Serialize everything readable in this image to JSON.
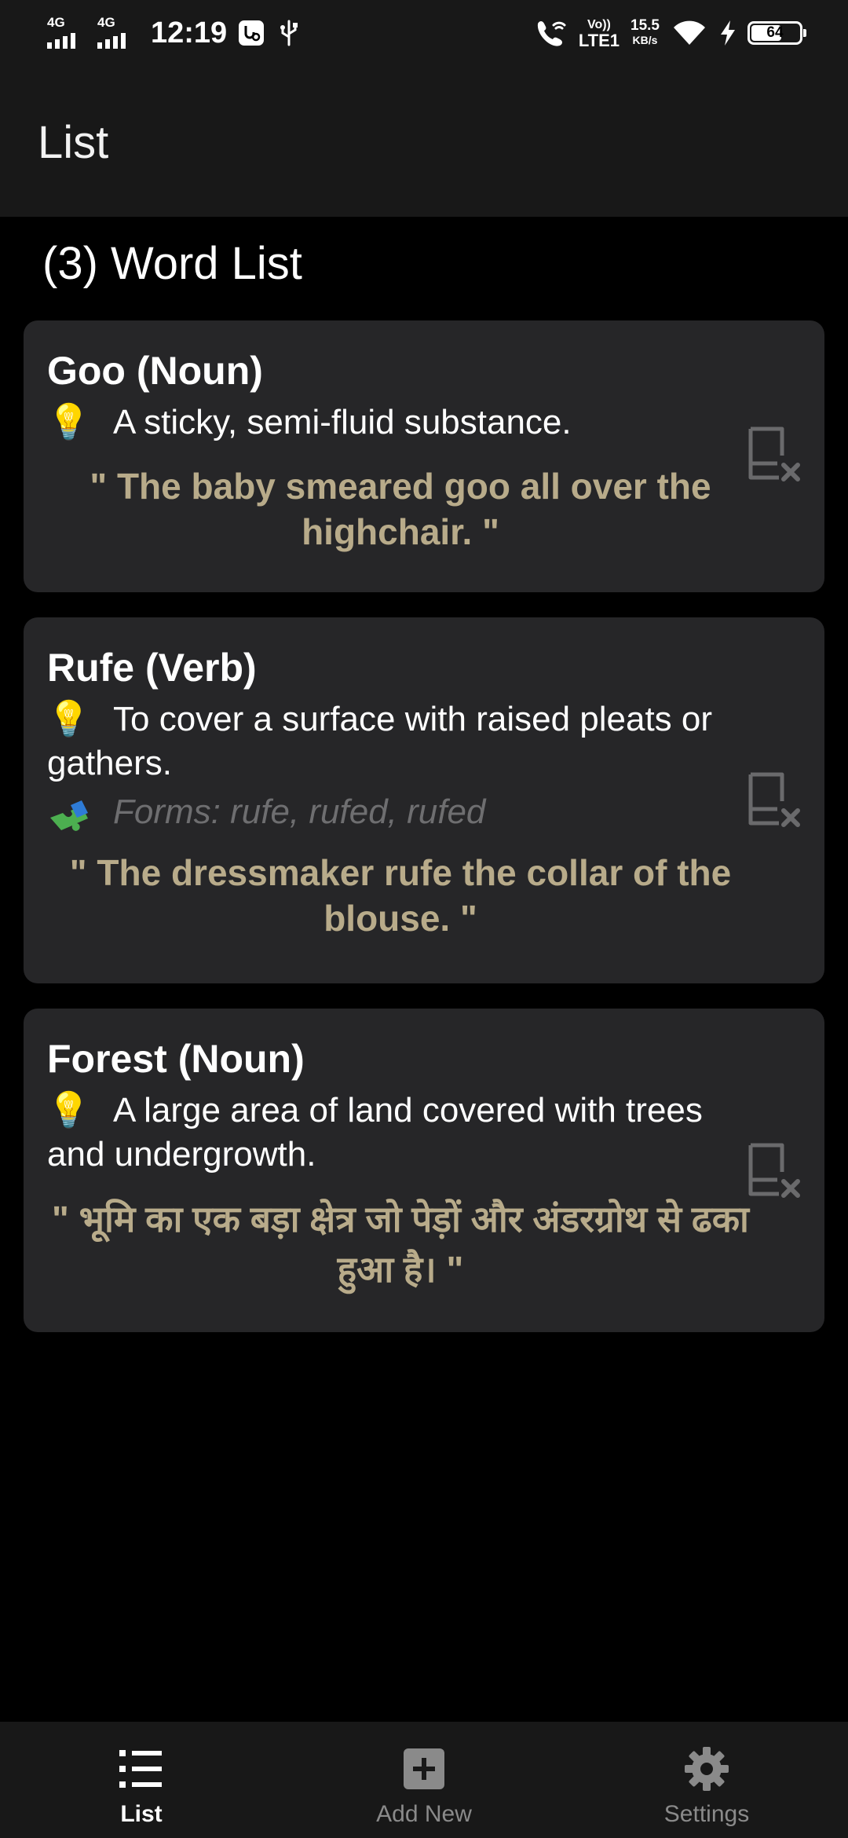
{
  "status_bar": {
    "sim1_network": "4G",
    "sim2_network": "4G",
    "time": "12:19",
    "volte_top": "Vo))",
    "volte_bottom": "LTE1",
    "speed_value": "15.5",
    "speed_unit": "KB/s",
    "battery_level": "64",
    "battery_fraction": 0.64
  },
  "app_bar": {
    "title": "List"
  },
  "list": {
    "heading": "(3) Word List",
    "items": [
      {
        "word": "Goo (Noun)",
        "meaning": "A sticky, semi-fluid substance.",
        "example": "\" The baby smeared goo all over the highchair. \""
      },
      {
        "word": "Rufe (Verb)",
        "meaning": "To cover a surface with raised pleats or gathers.",
        "forms": "Forms:  rufe,  rufed,  rufed",
        "example": "\" The dressmaker rufe the collar of the blouse. \""
      },
      {
        "word": "Forest (Noun)",
        "meaning": "A large area of land covered with trees and undergrowth.",
        "example": "\" भूमि का एक बड़ा क्षेत्र जो पेड़ों और अंडरग्रोथ से ढका हुआ है। \""
      }
    ]
  },
  "bottom_nav": {
    "items": [
      {
        "label": "List",
        "icon": "list-icon",
        "active": true
      },
      {
        "label": "Add New",
        "icon": "add-box-icon",
        "active": false
      },
      {
        "label": "Settings",
        "icon": "gear-icon",
        "active": false
      }
    ]
  },
  "colors": {
    "background": "#000000",
    "surface": "#262628",
    "bar": "#181818",
    "example_text": "#b8ab8a",
    "forms_text": "#6e6e70",
    "nav_active": "#ffffff",
    "nav_inactive": "#8a8a8a"
  }
}
